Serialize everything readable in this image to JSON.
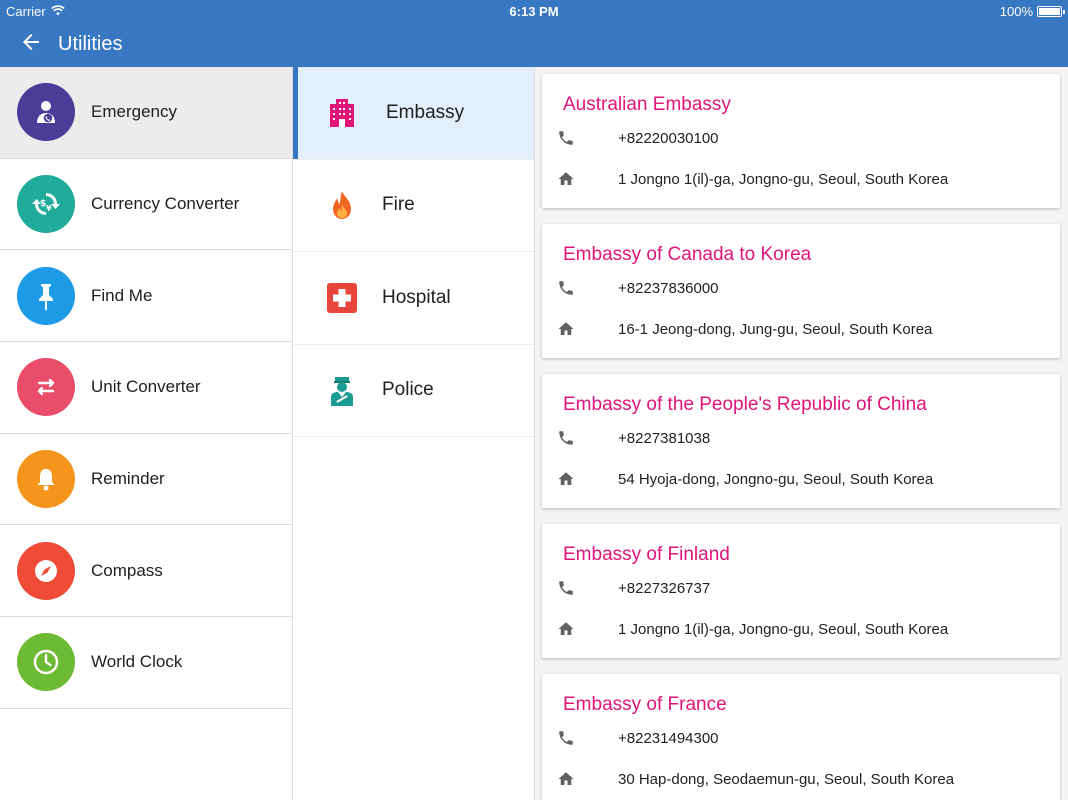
{
  "status_bar": {
    "carrier": "Carrier",
    "time": "6:13 PM",
    "battery": "100%"
  },
  "app_bar": {
    "title": "Utilities",
    "back_icon": "arrow-back-icon"
  },
  "utilities": [
    {
      "label": "Emergency",
      "icon": "person-phone-icon",
      "color": "#4a3c97",
      "active": true
    },
    {
      "label": "Currency Converter",
      "icon": "currency-exchange-icon",
      "color": "#20ab9b"
    },
    {
      "label": "Find Me",
      "icon": "pin-icon",
      "color": "#1e9be6"
    },
    {
      "label": "Unit Converter",
      "icon": "swap-arrows-icon",
      "color": "#ea4d6a"
    },
    {
      "label": "Reminder",
      "icon": "bell-icon",
      "color": "#f6951c"
    },
    {
      "label": "Compass",
      "icon": "compass-icon",
      "color": "#ef4b36"
    },
    {
      "label": "World Clock",
      "icon": "clock-icon",
      "color": "#6dbb34"
    }
  ],
  "categories": [
    {
      "label": "Embassy",
      "icon": "building-icon",
      "active": true
    },
    {
      "label": "Fire",
      "icon": "fire-icon"
    },
    {
      "label": "Hospital",
      "icon": "hospital-icon"
    },
    {
      "label": "Police",
      "icon": "police-officer-icon"
    }
  ],
  "embassies": [
    {
      "name": "Australian Embassy",
      "phone": "+82220030100",
      "address": "1 Jongno 1(il)-ga, Jongno-gu, Seoul, South Korea"
    },
    {
      "name": "Embassy of Canada to Korea",
      "phone": "+82237836000",
      "address": "16-1 Jeong-dong, Jung-gu, Seoul, South Korea"
    },
    {
      "name": "Embassy of the People's Republic of China",
      "phone": "+8227381038",
      "address": "54 Hyoja-dong, Jongno-gu, Seoul, South Korea"
    },
    {
      "name": "Embassy of Finland",
      "phone": "+8227326737",
      "address": "1 Jongno 1(il)-ga, Jongno-gu, Seoul, South Korea"
    },
    {
      "name": "Embassy of France",
      "phone": "+82231494300",
      "address": "30 Hap-dong, Seodaemun-gu, Seoul, South Korea"
    }
  ],
  "colors": {
    "app_bar": "#3877c1",
    "title_accent": "#e0147a"
  }
}
